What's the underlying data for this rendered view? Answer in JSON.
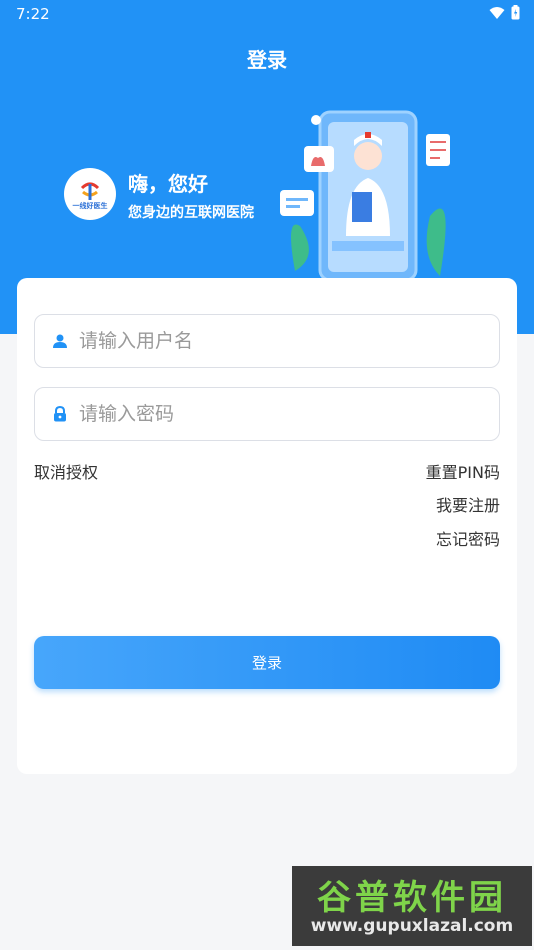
{
  "status_bar": {
    "time": "7:22",
    "wifi_icon": "wifi-icon",
    "battery_icon": "battery-icon"
  },
  "header": {
    "title": "登录"
  },
  "banner": {
    "logo_text": "一线好医生",
    "greeting": "嗨，您好",
    "tagline": "您身边的互联网医院"
  },
  "form": {
    "username_placeholder": "请输入用户名",
    "password_placeholder": "请输入密码",
    "cancel_auth": "取消授权",
    "reset_pin": "重置PIN码",
    "register": "我要注册",
    "forgot_password": "忘记密码",
    "login_button": "登录"
  },
  "watermark": {
    "name": "谷普软件园",
    "url": "www.gupuxlazal.com"
  },
  "colors": {
    "primary": "#2192f6",
    "background": "#f5f6f8",
    "card": "#ffffff"
  }
}
